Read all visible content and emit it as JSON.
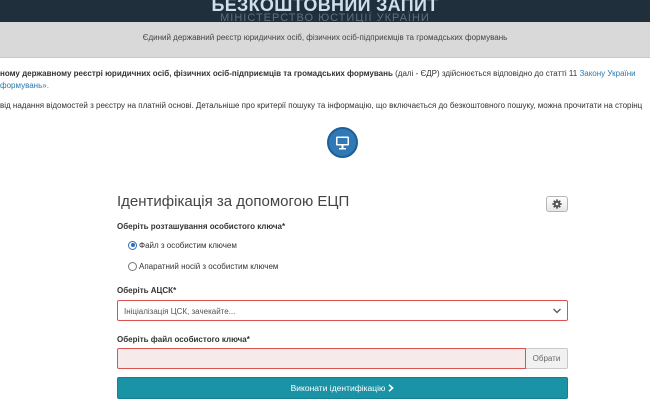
{
  "header": {
    "title": "БЕЗКОШТОВНИЙ ЗАПИТ",
    "ghost_text": "МІНІСТЕРСТВО ЮСТИЦІЇ УКРАЇНИ",
    "subtitle": "Єдиний державний реєстр юридичних осіб, фізичних осіб-підприємців та громадських формувань"
  },
  "info": {
    "line1_bold": "ному державному реєстрі юридичних осіб, фізичних осіб-підприємців та громадських формувань",
    "line1_normal": " (далі - ЄДР) здійснюється відповідно до статті 11 ",
    "line1_link": "Закону України",
    "line1b_link": "формувань».",
    "line2": "від надання відомостей з реєстру на платній основі. Детальніше про критерії пошуку та інформацію, що включається до безкоштовного пошуку, можна прочитати на сторінц"
  },
  "icons": {
    "monitor": "monitor-icon",
    "gear": "gear-icon",
    "dropdown": "chevron-down-icon",
    "submit_arrow": "chevron-right-icon"
  },
  "form": {
    "title": "Ідентифікація за допомогою ЕЦП",
    "key_location_label": "Оберіть розташування особистого ключа*",
    "radio_file": "Файл з особистим ключем",
    "radio_hardware": "Апаратний носій з особистим ключем",
    "selected_location": "file",
    "acsk_label": "Оберіть АЦСК*",
    "acsk_value": "Ініціалізація ЦСК, зачекайте...",
    "file_label": "Оберіть файл особистого ключа*",
    "file_value": "",
    "browse_label": "Обрати",
    "submit_label": "Виконати ідентифікацію"
  },
  "colors": {
    "topbar": "#1f2f3b",
    "header_band": "#d9d9d9",
    "link": "#2a7ab0",
    "error_border": "#d9534f",
    "submit": "#1b93a6",
    "icon_circle": "#2f79b7"
  }
}
